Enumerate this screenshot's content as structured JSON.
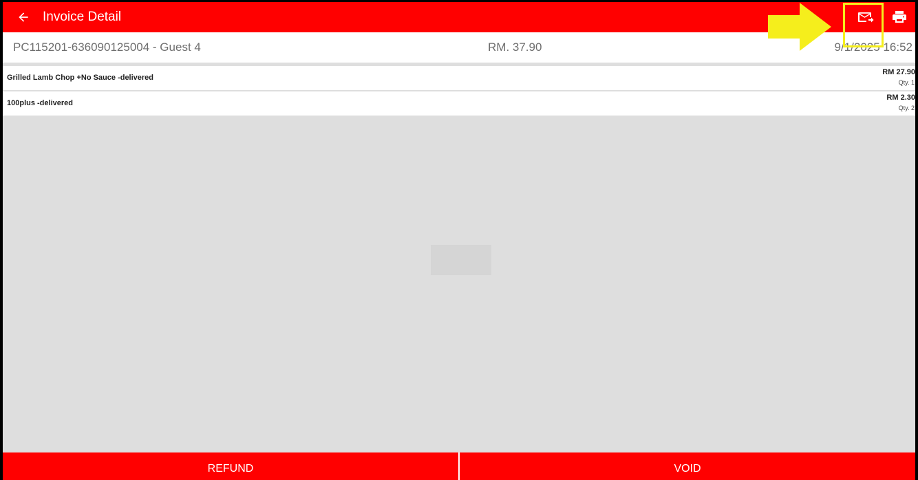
{
  "appbar": {
    "title": "Invoice Detail",
    "back_icon": "arrow-left-icon",
    "email_icon": "email-send-icon",
    "print_icon": "printer-icon",
    "color": "#ff0000"
  },
  "invoice": {
    "id": "PC115201-636090125004 - Guest 4",
    "total": "RM. 37.90",
    "datetime": "9/1/2025 16:52"
  },
  "items": [
    {
      "name": "Grilled Lamb Chop  +No Sauce -delivered",
      "price": "RM 27.90",
      "qty": "Qty. 1"
    },
    {
      "name": "100plus  -delivered",
      "price": "RM 2.30",
      "qty": "Qty. 2"
    }
  ],
  "footer": {
    "refund_label": "REFUND",
    "void_label": "VOID"
  },
  "annotation": {
    "highlight_color": "#f5ee1c"
  }
}
